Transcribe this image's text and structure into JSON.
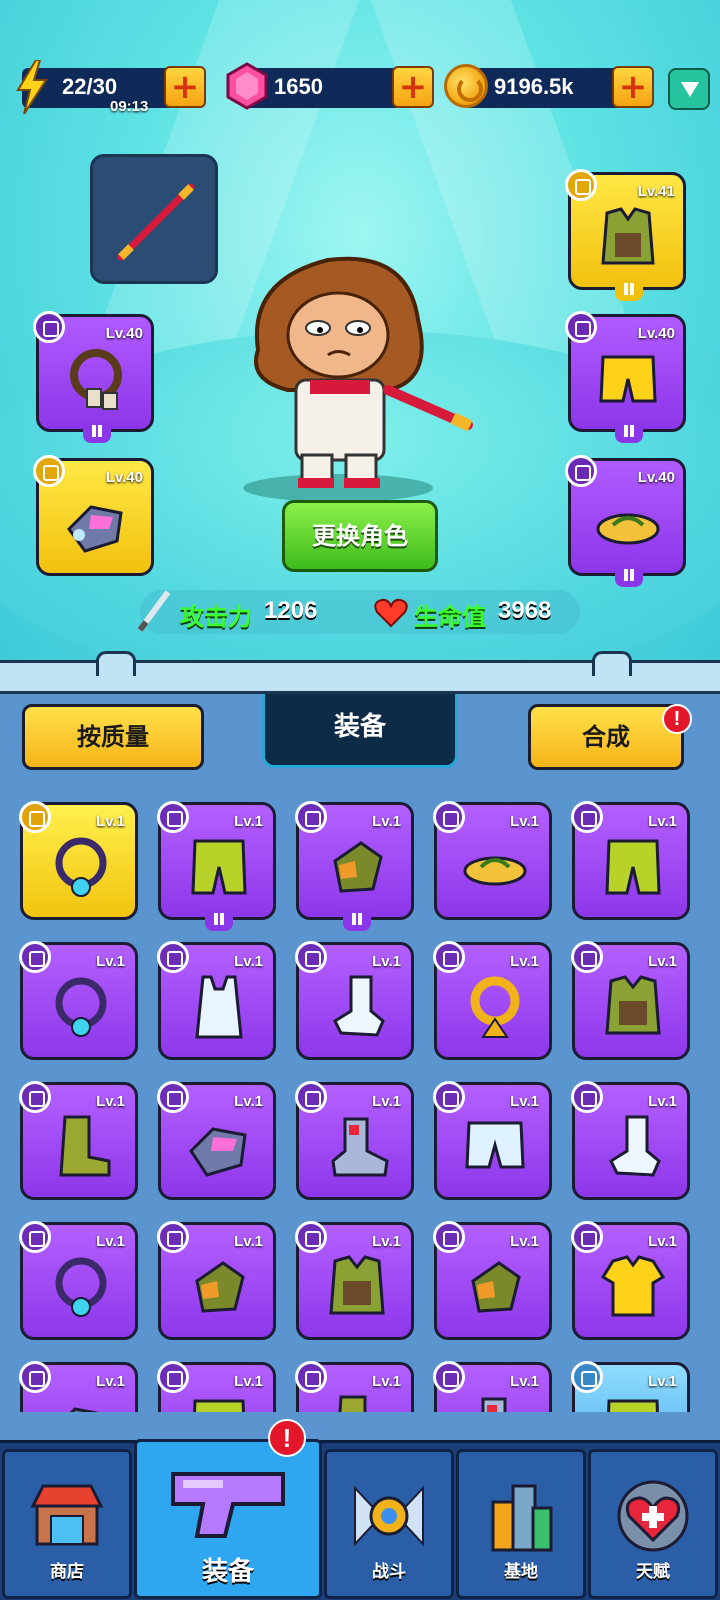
{
  "resources": {
    "energy": "22/30",
    "energy_timer": "09:13",
    "gems": "1650",
    "coins": "9196.5k"
  },
  "character": {
    "change_button": "更换角色",
    "attack_label": "攻击力",
    "attack_value": "1206",
    "hp_label": "生命值",
    "hp_value": "3968"
  },
  "equipped": {
    "necklace_level": "Lv.40",
    "gloves_level": "Lv.40",
    "armor_level": "Lv.41",
    "pants_level": "Lv.40",
    "shoes_level": "Lv.40"
  },
  "inventory": {
    "sort_button": "按质量",
    "tab_title": "装备",
    "merge_button": "合成",
    "merge_alert": "!",
    "items": [
      {
        "level": "Lv.1",
        "rarity": "yellow",
        "icon": "necklace-icon"
      },
      {
        "level": "Lv.1",
        "rarity": "purple",
        "icon": "pants-icon"
      },
      {
        "level": "Lv.1",
        "rarity": "purple",
        "icon": "glove-icon"
      },
      {
        "level": "Lv.1",
        "rarity": "purple",
        "icon": "sandal-icon"
      },
      {
        "level": "Lv.1",
        "rarity": "purple",
        "icon": "pants-icon"
      },
      {
        "level": "Lv.1",
        "rarity": "purple",
        "icon": "necklace-icon"
      },
      {
        "level": "Lv.1",
        "rarity": "purple",
        "icon": "tank-top-icon"
      },
      {
        "level": "Lv.1",
        "rarity": "purple",
        "icon": "sock-icon"
      },
      {
        "level": "Lv.1",
        "rarity": "purple",
        "icon": "scarf-icon"
      },
      {
        "level": "Lv.1",
        "rarity": "purple",
        "icon": "armor-icon"
      },
      {
        "level": "Lv.1",
        "rarity": "purple",
        "icon": "boot-icon"
      },
      {
        "level": "Lv.1",
        "rarity": "purple",
        "icon": "gauntlet-icon"
      },
      {
        "level": "Lv.1",
        "rarity": "purple",
        "icon": "sneaker-icon"
      },
      {
        "level": "Lv.1",
        "rarity": "purple",
        "icon": "shorts-icon"
      },
      {
        "level": "Lv.1",
        "rarity": "purple",
        "icon": "sock-icon"
      },
      {
        "level": "Lv.1",
        "rarity": "purple",
        "icon": "necklace-icon"
      },
      {
        "level": "Lv.1",
        "rarity": "purple",
        "icon": "glove-icon"
      },
      {
        "level": "Lv.1",
        "rarity": "purple",
        "icon": "armor-icon"
      },
      {
        "level": "Lv.1",
        "rarity": "purple",
        "icon": "glove-icon"
      },
      {
        "level": "Lv.1",
        "rarity": "purple",
        "icon": "shirt-icon"
      },
      {
        "level": "Lv.1",
        "rarity": "purple",
        "icon": "gauntlet-icon"
      },
      {
        "level": "Lv.1",
        "rarity": "purple",
        "icon": "pants-icon"
      },
      {
        "level": "Lv.1",
        "rarity": "purple",
        "icon": "boot-icon"
      },
      {
        "level": "Lv.1",
        "rarity": "purple",
        "icon": "sneaker-icon"
      },
      {
        "level": "Lv.1",
        "rarity": "blue",
        "icon": "pants-icon"
      }
    ]
  },
  "nav": {
    "shop": "商店",
    "equipment": "装备",
    "equipment_alert": "!",
    "battle": "战斗",
    "base": "基地",
    "talent": "天赋"
  },
  "colors": {
    "purple": "#a24cf8",
    "yellow": "#f7d41d",
    "blue": "#5fb8ee",
    "accent_green": "#3dff2e"
  }
}
